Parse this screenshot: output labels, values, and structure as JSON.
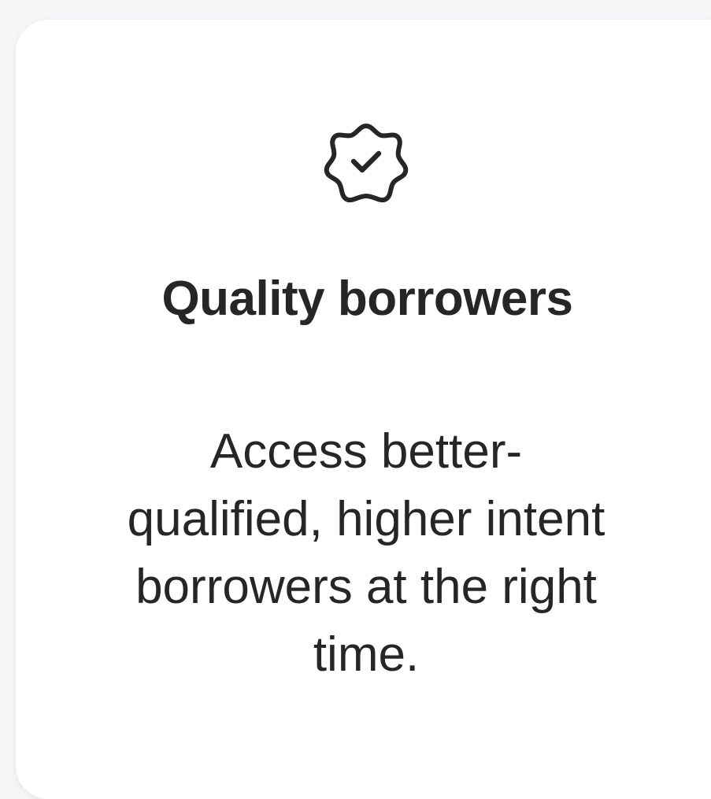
{
  "card": {
    "icon": "verified-badge-icon",
    "title": "Quality borrowers",
    "description": "Access better-qualified, higher intent borrowers at the right time."
  },
  "colors": {
    "background": "#f5f5f7",
    "card": "#ffffff",
    "text": "#262626"
  }
}
